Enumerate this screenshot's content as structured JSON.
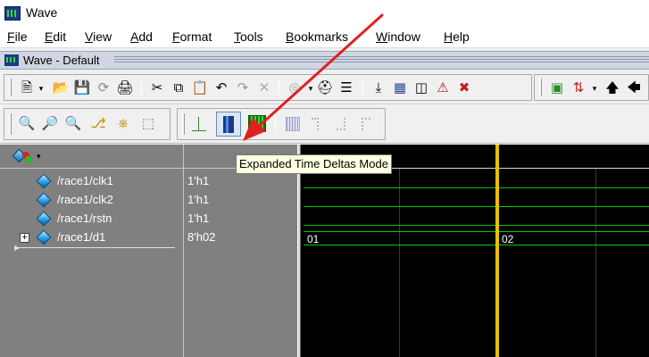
{
  "window": {
    "title": "Wave"
  },
  "menu": [
    {
      "label": "File"
    },
    {
      "label": "Edit"
    },
    {
      "label": "View"
    },
    {
      "label": "Add"
    },
    {
      "label": "Format"
    },
    {
      "label": "Tools"
    },
    {
      "label": "Bookmarks"
    },
    {
      "label": "Window"
    },
    {
      "label": "Help"
    }
  ],
  "subwindow": {
    "title": "Wave - Default"
  },
  "tooltip": {
    "text": "Expanded Time Deltas Mode"
  },
  "signals": [
    {
      "name": "/race1/clk1",
      "value": "1'h1"
    },
    {
      "name": "/race1/clk2",
      "value": "1'h1"
    },
    {
      "name": "/race1/rstn",
      "value": "1'h1"
    },
    {
      "name": "/race1/d1",
      "value": "8'h02"
    }
  ],
  "wave": {
    "bus_labels": [
      "01",
      "02"
    ]
  },
  "colors": {
    "wave_bg": "#000000",
    "wave_signal": "#00c800",
    "cursor": "#e8c000",
    "change_marker": "#ff7a00",
    "annotation_arrow": "#e02020"
  }
}
